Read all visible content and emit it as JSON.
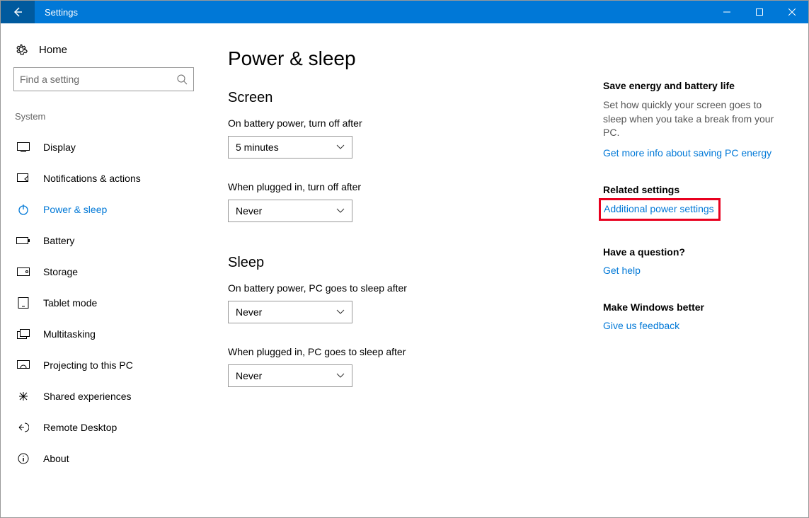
{
  "titlebar": {
    "title": "Settings"
  },
  "sidebar": {
    "home": "Home",
    "search_placeholder": "Find a setting",
    "group": "System",
    "items": [
      {
        "label": "Display"
      },
      {
        "label": "Notifications & actions"
      },
      {
        "label": "Power & sleep"
      },
      {
        "label": "Battery"
      },
      {
        "label": "Storage"
      },
      {
        "label": "Tablet mode"
      },
      {
        "label": "Multitasking"
      },
      {
        "label": "Projecting to this PC"
      },
      {
        "label": "Shared experiences"
      },
      {
        "label": "Remote Desktop"
      },
      {
        "label": "About"
      }
    ]
  },
  "main": {
    "title": "Power & sleep",
    "screen": {
      "heading": "Screen",
      "battery_label": "On battery power, turn off after",
      "battery_value": "5 minutes",
      "plugged_label": "When plugged in, turn off after",
      "plugged_value": "Never"
    },
    "sleep": {
      "heading": "Sleep",
      "battery_label": "On battery power, PC goes to sleep after",
      "battery_value": "Never",
      "plugged_label": "When plugged in, PC goes to sleep after",
      "plugged_value": "Never"
    }
  },
  "aside": {
    "energy": {
      "heading": "Save energy and battery life",
      "text": "Set how quickly your screen goes to sleep when you take a break from your PC.",
      "link": "Get more info about saving PC energy"
    },
    "related": {
      "heading": "Related settings",
      "link": "Additional power settings"
    },
    "question": {
      "heading": "Have a question?",
      "link": "Get help"
    },
    "better": {
      "heading": "Make Windows better",
      "link": "Give us feedback"
    }
  }
}
